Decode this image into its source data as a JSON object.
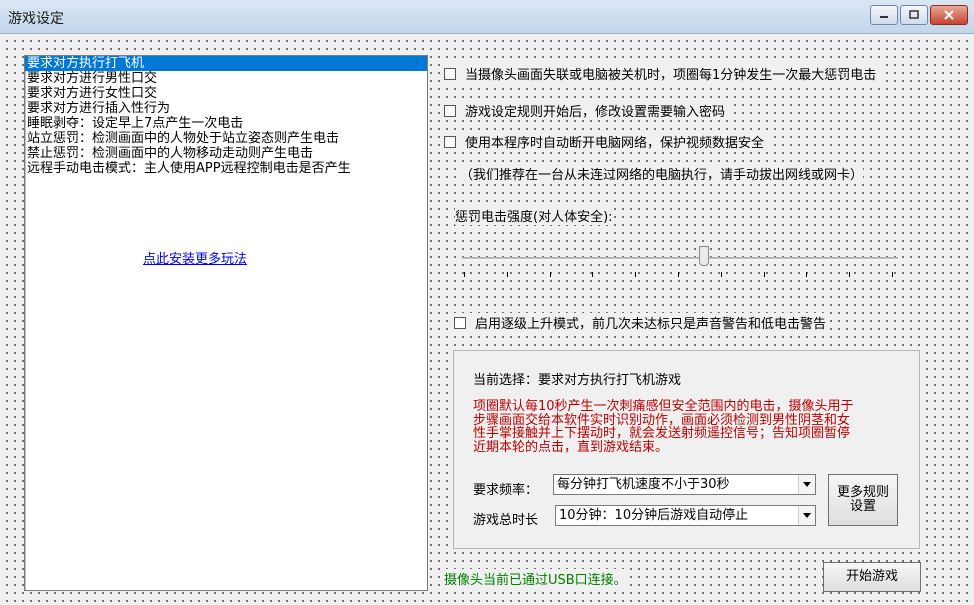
{
  "window": {
    "title": "游戏设定"
  },
  "game_list": {
    "selected_index": 0,
    "items": [
      "要求对方执行打飞机",
      "要求对方进行男性口交",
      "要求对方进行女性口交",
      "要求对方进行插入性行为",
      "睡眠剥夺：设定早上7点产生一次电击",
      "站立惩罚：检测画面中的人物处于站立姿态则产生电击",
      "禁止惩罚：检测画面中的人物移动走动则产生电击",
      "远程手动电击模式：主人使用APP远程控制电击是否产生"
    ],
    "install_link": "点此安装更多玩法"
  },
  "options": {
    "camera_disconnect": {
      "label": "当摄像头画面失联或电脑被关机时，项圈每1分钟发生一次最大惩罚电击",
      "checked": false
    },
    "password_lock": {
      "label": "游戏设定规则开始后，修改设置需要输入密码",
      "checked": false
    },
    "auto_disconnect": {
      "label": "使用本程序时自动断开电脑网络，保护视频数据安全",
      "checked": false
    },
    "network_note": "（我们推荐在一台从未连过网络的电脑执行，请手动拔出网线或网卡）",
    "escalation": {
      "label": "启用逐级上升模式，前几次未达标只是声音警告和低电击警告",
      "checked": false
    }
  },
  "intensity": {
    "label": "惩罚电击强度(对人体安全):",
    "ticks": 11,
    "value_fraction": 0.56
  },
  "details": {
    "current_selection": "当前选择：要求对方执行打飞机游戏",
    "description_lines": [
      "项圈默认每10秒产生一次刺痛感但安全范围内的电击，摄像头用于",
      "步骤画面交给本软件实时识别动作，画面必须检测到男性阴茎和女",
      "性手掌接触并上下摆动时，就会发送射频遥控信号；告知项圈暂停",
      "近期本轮的点击，直到游戏结束。"
    ],
    "frequency_label": "要求频率：",
    "frequency_value": "每分钟打飞机速度不小于30秒",
    "duration_label": "游戏总时长",
    "duration_value": "10分钟：10分钟后游戏自动停止",
    "more_rules_button": [
      "更多规则",
      "设置"
    ]
  },
  "status": "摄像头当前已通过USB口连接。",
  "start_button": "开始游戏",
  "colors": {
    "selection": "#0078d7",
    "warning_text": "#c00000",
    "status_text": "#008000",
    "link": "#0000ee"
  }
}
